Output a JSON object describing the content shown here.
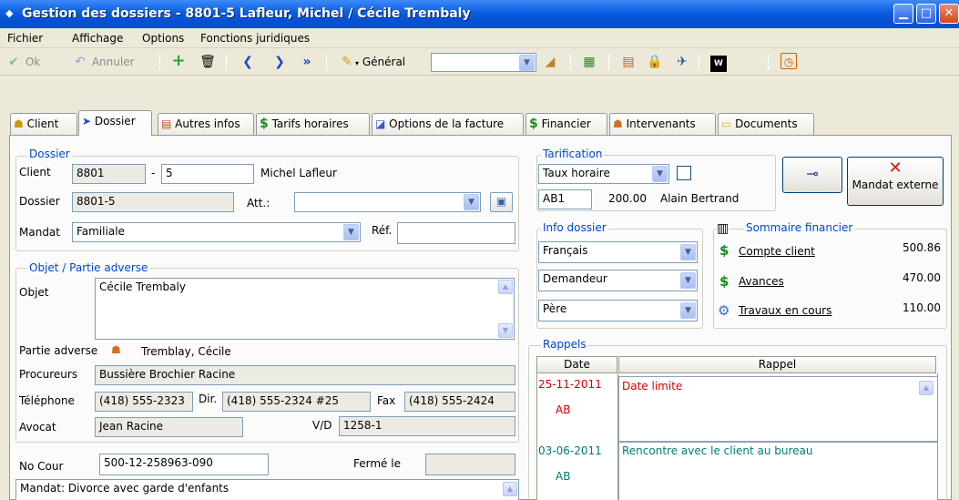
{
  "window": {
    "title": "Gestion des dossiers - 8801-5  Lafleur, Michel / Cécile Trembaly"
  },
  "menu": [
    "Fichier",
    "Affichage",
    "Options",
    "Fonctions juridiques"
  ],
  "toolbar": {
    "ok_label": "Ok",
    "cancel_label": "Annuler",
    "view_label": "Général",
    "view_value": ""
  },
  "tabs": [
    "Client",
    "Dossier",
    "Autres infos",
    "Tarifs horaires",
    "Options de la facture",
    "Financier",
    "Intervenants",
    "Documents"
  ],
  "dossier": {
    "group_label": "Dossier",
    "client_label": "Client",
    "client_num": "8801",
    "dash": "-",
    "client_sub": "5",
    "client_name": "Michel Lafleur",
    "dossier_label": "Dossier",
    "dossier_num": "8801-5",
    "att_label": "Att.:",
    "att_value": "",
    "mandat_label": "Mandat",
    "mandat_value": "Familiale",
    "ref_label": "Réf.",
    "ref_value": ""
  },
  "objet": {
    "group_label": "Objet / Partie adverse",
    "objet_label": "Objet",
    "objet_value": "Cécile Trembaly",
    "partie_label": "Partie adverse",
    "partie_value": "Tremblay, Cécile",
    "procureurs_label": "Procureurs",
    "procureurs_value": "Bussière Brochier Racine",
    "tel_label": "Téléphone",
    "tel_value": "(418) 555-2323",
    "dir_label": "Dir.",
    "dir_value": "(418) 555-2324 #25",
    "fax_label": "Fax",
    "fax_value": "(418) 555-2424",
    "avocat_label": "Avocat",
    "avocat_value": "Jean Racine",
    "vd_label": "V/D",
    "vd_value": "1258-1"
  },
  "cour": {
    "nocour_label": "No Cour",
    "nocour_value": "500-12-258963-090",
    "ferme_label": "Fermé le",
    "ferme_value": "",
    "mandat_note": "Mandat: Divorce avec garde d'enfants"
  },
  "tarification": {
    "group_label": "Tarification",
    "type_value": "Taux horaire",
    "code": "AB1",
    "rate": "200.00",
    "person": "Alain Bertrand"
  },
  "buttons": {
    "mandat_externe": "Mandat externe"
  },
  "info": {
    "group_label": "Info dossier",
    "langue": "Français",
    "role": "Demandeur",
    "parent": "Père"
  },
  "sommaire": {
    "group_label": "Sommaire financier",
    "items": [
      {
        "label": "Compte client",
        "value": "500.86"
      },
      {
        "label": "Avances",
        "value": "470.00"
      },
      {
        "label": "Travaux en cours",
        "value": "110.00"
      }
    ]
  },
  "rappels": {
    "group_label": "Rappels",
    "col_date": "Date",
    "col_rappel": "Rappel",
    "rows": [
      {
        "date": "25-11-2011",
        "initials": "AB",
        "text": "Date limite"
      },
      {
        "date": "03-06-2011",
        "initials": "AB",
        "text": "Rencontre avec le client au bureau"
      }
    ]
  },
  "colors": {
    "titlebar": "#0a5ce0",
    "group_label": "#0046d5",
    "money": "#1c8a1c",
    "reminder_red": "#d60000",
    "reminder_teal": "#007a7a"
  }
}
